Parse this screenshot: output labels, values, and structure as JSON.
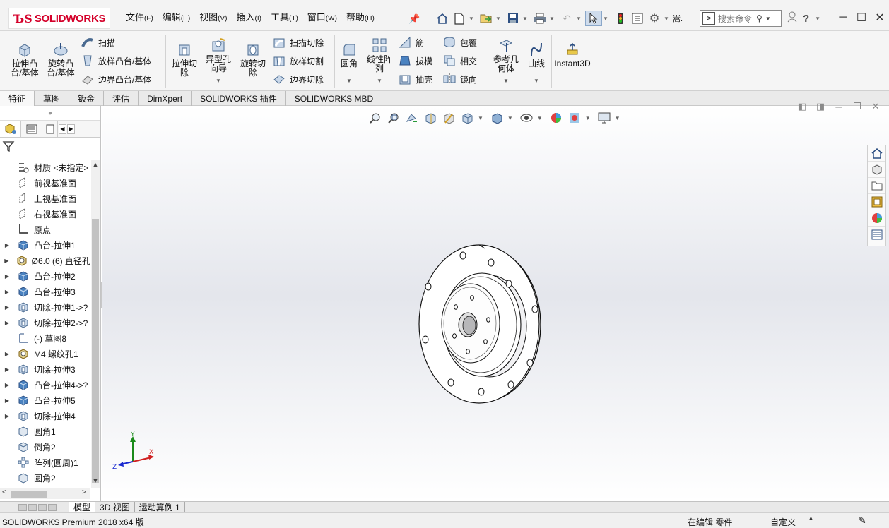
{
  "app": {
    "logo_text": "SOLIDWORKS",
    "accent_color": "#d4002a"
  },
  "menu": [
    {
      "label": "文件",
      "key": "(F)"
    },
    {
      "label": "编辑",
      "key": "(E)"
    },
    {
      "label": "视图",
      "key": "(V)"
    },
    {
      "label": "插入",
      "key": "(I)"
    },
    {
      "label": "工具",
      "key": "(T)"
    },
    {
      "label": "窗口",
      "key": "(W)"
    },
    {
      "label": "帮助",
      "key": "(H)"
    }
  ],
  "qat": {
    "icons": [
      "home-icon",
      "new-document-icon",
      "open-icon",
      "save-icon",
      "print-icon",
      "undo-icon",
      "select-arrow-icon",
      "traffic-light-icon",
      "file-properties-icon",
      "options-gear-icon"
    ],
    "overflow_label": "嵩."
  },
  "search": {
    "placeholder": "搜索命令"
  },
  "ribbon": {
    "extrude_boss": "拉伸凸\n台/基体",
    "revolve_boss": "旋转凸\n台/基体",
    "sweep": "扫描",
    "loft_boss": "放样凸台/基体",
    "boundary_boss": "边界凸台/基体",
    "extrude_cut": "拉伸切\n除",
    "hole_wizard": "异型孔\n向导",
    "revolve_cut": "旋转切\n除",
    "swept_cut": "扫描切除",
    "lofted_cut": "放样切割",
    "boundary_cut": "边界切除",
    "fillet": "圆角",
    "linear_pattern": "线性阵\n列",
    "rib": "筋",
    "draft": "拔模",
    "shell": "抽壳",
    "wrap": "包覆",
    "intersect": "相交",
    "mirror": "镜向",
    "ref_geometry": "参考几\n何体",
    "curves": "曲线",
    "instant3d": "Instant3D"
  },
  "cm_tabs": [
    "特征",
    "草图",
    "钣金",
    "评估",
    "DimXpert",
    "SOLIDWORKS 插件",
    "SOLIDWORKS MBD"
  ],
  "tree": [
    {
      "label": "材质 <未指定>",
      "icon": "material-icon",
      "expandable": false
    },
    {
      "label": "前视基准面",
      "icon": "plane-icon",
      "expandable": false
    },
    {
      "label": "上视基准面",
      "icon": "plane-icon",
      "expandable": false
    },
    {
      "label": "右视基准面",
      "icon": "plane-icon",
      "expandable": false
    },
    {
      "label": "原点",
      "icon": "origin-icon",
      "expandable": false
    },
    {
      "label": "凸台-拉伸1",
      "icon": "boss-extrude-icon",
      "expandable": true
    },
    {
      "label": "Ø6.0 (6) 直径孔",
      "icon": "hole-icon",
      "expandable": true
    },
    {
      "label": "凸台-拉伸2",
      "icon": "boss-extrude-icon",
      "expandable": true
    },
    {
      "label": "凸台-拉伸3",
      "icon": "boss-extrude-icon",
      "expandable": true
    },
    {
      "label": "切除-拉伸1->?",
      "icon": "cut-extrude-icon",
      "expandable": true
    },
    {
      "label": "切除-拉伸2->?",
      "icon": "cut-extrude-icon",
      "expandable": true
    },
    {
      "label": "(-) 草图8",
      "icon": "sketch-icon",
      "expandable": false
    },
    {
      "label": "M4 螺纹孔1",
      "icon": "hole-icon",
      "expandable": true
    },
    {
      "label": "切除-拉伸3",
      "icon": "cut-extrude-icon",
      "expandable": true
    },
    {
      "label": "凸台-拉伸4->?",
      "icon": "boss-extrude-icon",
      "expandable": true
    },
    {
      "label": "凸台-拉伸5",
      "icon": "boss-extrude-icon",
      "expandable": true
    },
    {
      "label": "切除-拉伸4",
      "icon": "cut-extrude-icon",
      "expandable": true
    },
    {
      "label": "圆角1",
      "icon": "fillet-icon",
      "expandable": false
    },
    {
      "label": "倒角2",
      "icon": "chamfer-icon",
      "expandable": false
    },
    {
      "label": "阵列(圆周)1",
      "icon": "circular-pattern-icon",
      "expandable": false
    },
    {
      "label": "圆角2",
      "icon": "fillet-icon",
      "expandable": false
    }
  ],
  "triad": {
    "x": "X",
    "y": "Y",
    "z": "Z"
  },
  "bottom_tabs": [
    "模型",
    "3D 视图",
    "运动算例 1"
  ],
  "status": {
    "product": "SOLIDWORKS Premium 2018 x64 版",
    "mode": "在编辑 零件",
    "units": "自定义"
  }
}
